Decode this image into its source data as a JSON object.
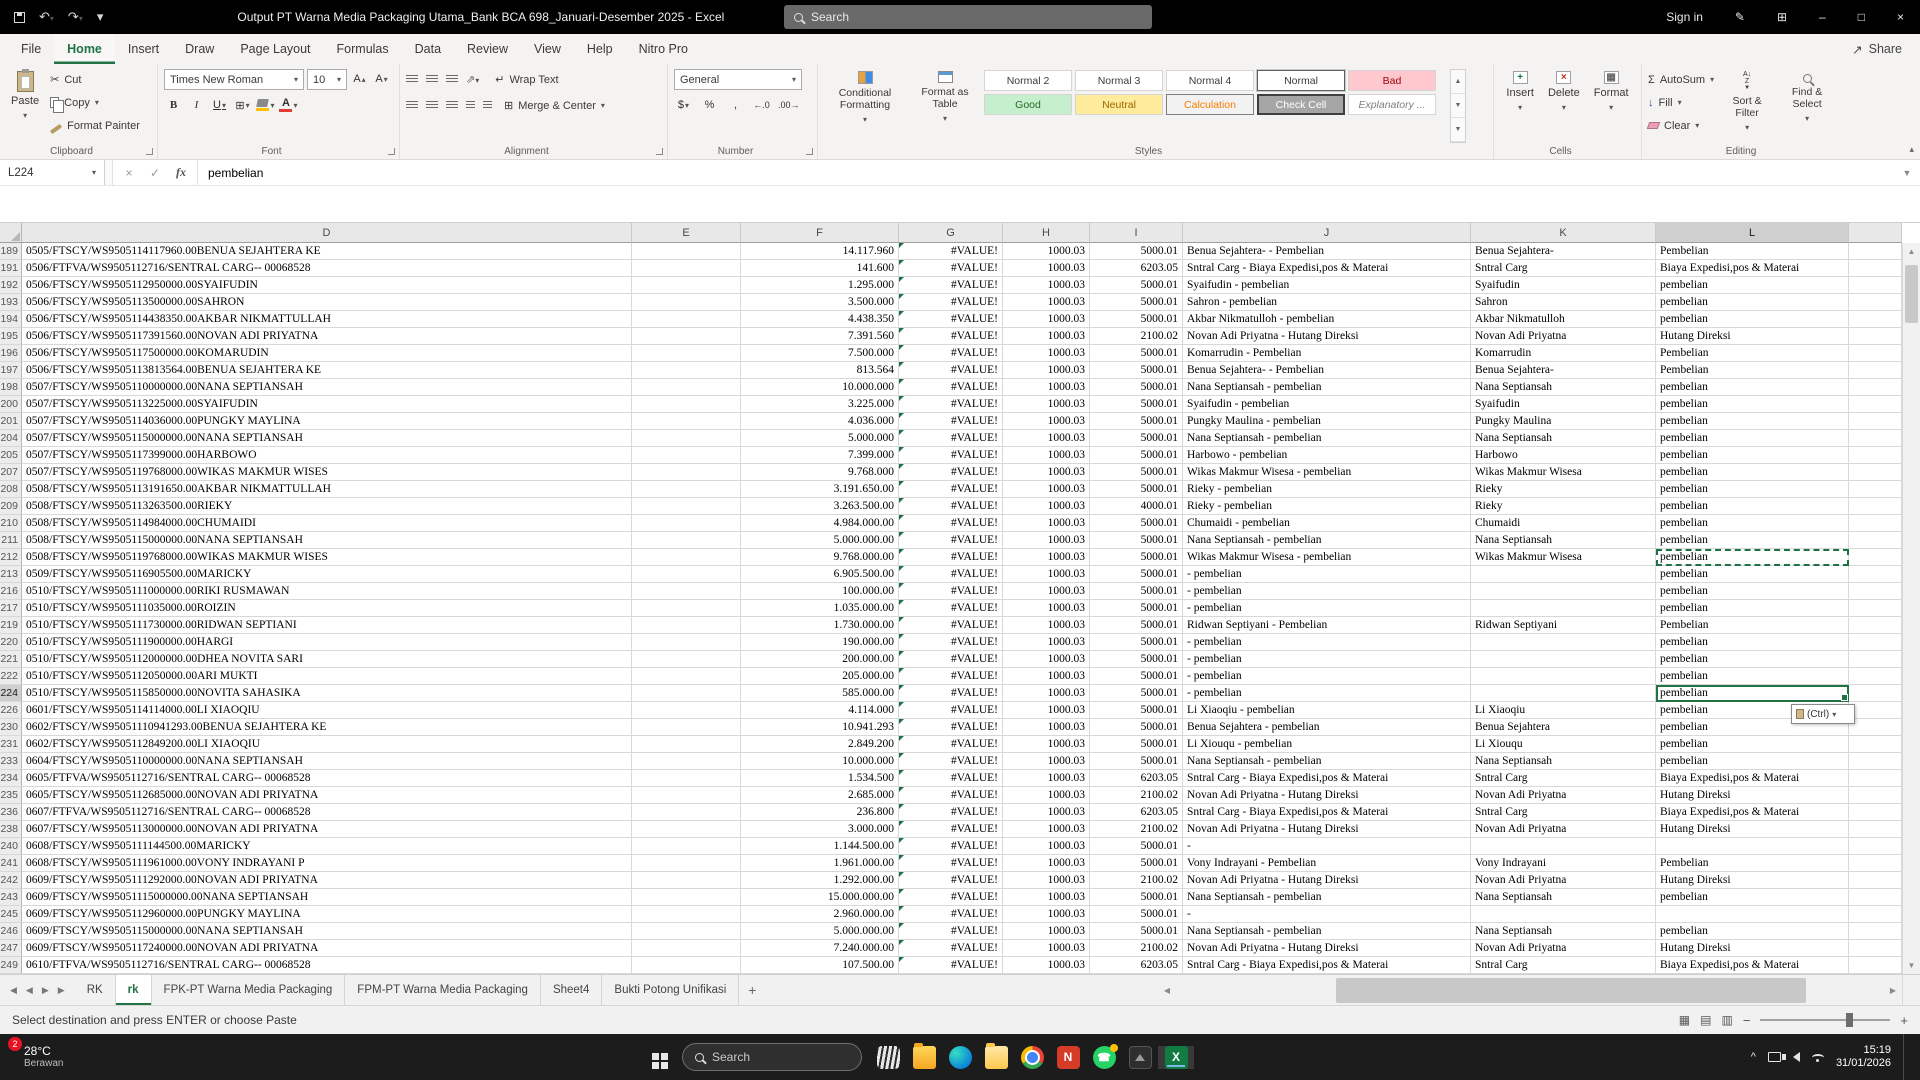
{
  "colors": {
    "accent_green": "#217346",
    "excel_brand": "#107c41",
    "bad_bg": "#ffc7ce",
    "bad_text": "#9c0006",
    "good_bg": "#c6efce",
    "good_text": "#276c24",
    "neutral_bg": "#ffeb9c",
    "neutral_text": "#9c6500",
    "calculation_text": "#fa7d00",
    "check_cell_bg": "#a5a5a5",
    "titlebar_bg": "#000000",
    "taskbar_bg": "#1c1c1c"
  },
  "title_bar": {
    "title": "Output PT Warna Media Packaging Utama_Bank BCA 698_Januari-Desember 2025  -  Excel",
    "search_placeholder": "Search",
    "sign_in": "Sign in"
  },
  "ribbon": {
    "tabs": [
      "File",
      "Home",
      "Insert",
      "Draw",
      "Page Layout",
      "Formulas",
      "Data",
      "Review",
      "View",
      "Help",
      "Nitro Pro"
    ],
    "active_tab": "Home",
    "share_label": "Share",
    "groups": {
      "clipboard": {
        "label": "Clipboard",
        "paste": "Paste",
        "cut": "Cut",
        "copy": "Copy",
        "format_painter": "Format Painter"
      },
      "font": {
        "label": "Font",
        "family": "Times New Roman",
        "size": "10"
      },
      "alignment": {
        "label": "Alignment",
        "wrap_text": "Wrap Text",
        "merge_center": "Merge & Center"
      },
      "number": {
        "label": "Number",
        "format": "General"
      },
      "styles": {
        "label": "Styles",
        "conditional": "Conditional Formatting",
        "format_table": "Format as Table",
        "gallery": [
          [
            "Normal 2",
            "plain"
          ],
          [
            "Normal 3",
            "plain"
          ],
          [
            "Normal 4",
            "plain"
          ],
          [
            "Normal",
            "selected"
          ],
          [
            "Bad",
            "bad"
          ],
          [
            "Good",
            "good"
          ],
          [
            "Neutral",
            "neutral"
          ],
          [
            "Calculation",
            "calc"
          ],
          [
            "Check Cell",
            "check"
          ],
          [
            "Explanatory ...",
            "explan"
          ]
        ]
      },
      "cells": {
        "label": "Cells",
        "insert": "Insert",
        "delete": "Delete",
        "format": "Format"
      },
      "editing": {
        "label": "Editing",
        "autosum": "AutoSum",
        "fill": "Fill",
        "clear": "Clear",
        "sort": "Sort & Filter",
        "find": "Find & Select"
      }
    }
  },
  "formula_bar": {
    "name_box": "L224",
    "formula": "pembelian"
  },
  "sheet": {
    "columns": [
      "D",
      "E",
      "F",
      "G",
      "H",
      "I",
      "J",
      "K",
      "L"
    ],
    "selected_column": "L",
    "selected_row": "224",
    "copied_row": "212",
    "active_cell": "L224",
    "paste_button_label": "(Ctrl)",
    "rows": [
      [
        "189",
        "0505/FTSCY/WS9505114117960.00BENUA SEJAHTERA KE",
        "14.117.960",
        "#VALUE!",
        "1000.03",
        "5000.01",
        "Benua Sejahtera- - Pembelian",
        "Benua Sejahtera-",
        "Pembelian"
      ],
      [
        "191",
        "0506/FTFVA/WS9505112716/SENTRAL CARG-- 00068528",
        "141.600",
        "#VALUE!",
        "1000.03",
        "6203.05",
        "Sntral Carg - Biaya Expedisi,pos & Materai",
        "Sntral Carg",
        "Biaya Expedisi,pos & Materai"
      ],
      [
        "192",
        "0506/FTSCY/WS9505112950000.00SYAIFUDIN",
        "1.295.000",
        "#VALUE!",
        "1000.03",
        "5000.01",
        "Syaifudin - pembelian",
        "Syaifudin",
        "pembelian"
      ],
      [
        "193",
        "0506/FTSCY/WS9505113500000.00SAHRON",
        "3.500.000",
        "#VALUE!",
        "1000.03",
        "5000.01",
        "Sahron - pembelian",
        "Sahron",
        "pembelian"
      ],
      [
        "194",
        "0506/FTSCY/WS9505114438350.00AKBAR NIKMATTULLAH",
        "4.438.350",
        "#VALUE!",
        "1000.03",
        "5000.01",
        "Akbar Nikmatulloh - pembelian",
        "Akbar Nikmatulloh",
        "pembelian"
      ],
      [
        "195",
        "0506/FTSCY/WS9505117391560.00NOVAN ADI PRIYATNA",
        "7.391.560",
        "#VALUE!",
        "1000.03",
        "2100.02",
        "Novan Adi Priyatna - Hutang Direksi",
        "Novan Adi Priyatna",
        "Hutang Direksi"
      ],
      [
        "196",
        "0506/FTSCY/WS9505117500000.00KOMARUDIN",
        "7.500.000",
        "#VALUE!",
        "1000.03",
        "5000.01",
        "Komarrudin - Pembelian",
        "Komarrudin",
        "Pembelian"
      ],
      [
        "197",
        "0506/FTSCY/WS9505113813564.00BENUA SEJAHTERA KE",
        "813.564",
        "#VALUE!",
        "1000.03",
        "5000.01",
        "Benua Sejahtera- - Pembelian",
        "Benua Sejahtera-",
        "Pembelian"
      ],
      [
        "198",
        "0507/FTSCY/WS9505110000000.00NANA SEPTIANSAH",
        "10.000.000",
        "#VALUE!",
        "1000.03",
        "5000.01",
        "Nana Septiansah - pembelian",
        "Nana Septiansah",
        "pembelian"
      ],
      [
        "200",
        "0507/FTSCY/WS9505113225000.00SYAIFUDIN",
        "3.225.000",
        "#VALUE!",
        "1000.03",
        "5000.01",
        "Syaifudin - pembelian",
        "Syaifudin",
        "pembelian"
      ],
      [
        "201",
        "0507/FTSCY/WS9505114036000.00PUNGKY MAYLINA",
        "4.036.000",
        "#VALUE!",
        "1000.03",
        "5000.01",
        "Pungky Maulina - pembelian",
        "Pungky Maulina",
        "pembelian"
      ],
      [
        "204",
        "0507/FTSCY/WS9505115000000.00NANA SEPTIANSAH",
        "5.000.000",
        "#VALUE!",
        "1000.03",
        "5000.01",
        "Nana Septiansah - pembelian",
        "Nana Septiansah",
        "pembelian"
      ],
      [
        "205",
        "0507/FTSCY/WS9505117399000.00HARBOWO",
        "7.399.000",
        "#VALUE!",
        "1000.03",
        "5000.01",
        "Harbowo - pembelian",
        "Harbowo",
        "pembelian"
      ],
      [
        "207",
        "0507/FTSCY/WS9505119768000.00WIKAS MAKMUR WISES",
        "9.768.000",
        "#VALUE!",
        "1000.03",
        "5000.01",
        "Wikas Makmur Wisesa - pembelian",
        "Wikas Makmur Wisesa",
        "pembelian"
      ],
      [
        "208",
        "0508/FTSCY/WS9505113191650.00AKBAR NIKMATTULLAH",
        "3.191.650.00",
        "#VALUE!",
        "1000.03",
        "5000.01",
        "Rieky - pembelian",
        "Rieky",
        "pembelian"
      ],
      [
        "209",
        "0508/FTSCY/WS9505113263500.00RIEKY",
        "3.263.500.00",
        "#VALUE!",
        "1000.03",
        "4000.01",
        "Rieky - pembelian",
        "Rieky",
        "pembelian"
      ],
      [
        "210",
        "0508/FTSCY/WS9505114984000.00CHUMAIDI",
        "4.984.000.00",
        "#VALUE!",
        "1000.03",
        "5000.01",
        "Chumaidi - pembelian",
        "Chumaidi",
        "pembelian"
      ],
      [
        "211",
        "0508/FTSCY/WS9505115000000.00NANA SEPTIANSAH",
        "5.000.000.00",
        "#VALUE!",
        "1000.03",
        "5000.01",
        "Nana Septiansah - pembelian",
        "Nana Septiansah",
        "pembelian"
      ],
      [
        "212",
        "0508/FTSCY/WS9505119768000.00WIKAS MAKMUR WISES",
        "9.768.000.00",
        "#VALUE!",
        "1000.03",
        "5000.01",
        "Wikas Makmur Wisesa - pembelian",
        "Wikas Makmur Wisesa",
        "pembelian"
      ],
      [
        "213",
        "0509/FTSCY/WS9505116905500.00MARICKY",
        "6.905.500.00",
        "#VALUE!",
        "1000.03",
        "5000.01",
        "- pembelian",
        "",
        "pembelian"
      ],
      [
        "216",
        "0510/FTSCY/WS9505111000000.00RIKI RUSMAWAN",
        "100.000.00",
        "#VALUE!",
        "1000.03",
        "5000.01",
        "- pembelian",
        "",
        "pembelian"
      ],
      [
        "217",
        "0510/FTSCY/WS9505111035000.00ROIZIN",
        "1.035.000.00",
        "#VALUE!",
        "1000.03",
        "5000.01",
        "- pembelian",
        "",
        "pembelian"
      ],
      [
        "219",
        "0510/FTSCY/WS9505111730000.00RIDWAN SEPTIANI",
        "1.730.000.00",
        "#VALUE!",
        "1000.03",
        "5000.01",
        "Ridwan Septiyani - Pembelian",
        "Ridwan Septiyani",
        "Pembelian"
      ],
      [
        "220",
        "0510/FTSCY/WS9505111900000.00HARGI",
        "190.000.00",
        "#VALUE!",
        "1000.03",
        "5000.01",
        "- pembelian",
        "",
        "pembelian"
      ],
      [
        "221",
        "0510/FTSCY/WS9505112000000.00DHEA NOVITA SARI",
        "200.000.00",
        "#VALUE!",
        "1000.03",
        "5000.01",
        "- pembelian",
        "",
        "pembelian"
      ],
      [
        "222",
        "0510/FTSCY/WS9505112050000.00ARI MUKTI",
        "205.000.00",
        "#VALUE!",
        "1000.03",
        "5000.01",
        "- pembelian",
        "",
        "pembelian"
      ],
      [
        "224",
        "0510/FTSCY/WS9505115850000.00NOVITA SAHASIKA",
        "585.000.00",
        "#VALUE!",
        "1000.03",
        "5000.01",
        "- pembelian",
        "",
        "pembelian"
      ],
      [
        "226",
        "0601/FTSCY/WS9505114114000.00LI XIAOQIU",
        "4.114.000",
        "#VALUE!",
        "1000.03",
        "5000.01",
        "Li Xiaoqiu - pembelian",
        "Li Xiaoqiu",
        "pembelian"
      ],
      [
        "230",
        "0602/FTSCY/WS95051110941293.00BENUA SEJAHTERA KE",
        "10.941.293",
        "#VALUE!",
        "1000.03",
        "5000.01",
        "Benua Sejahtera - pembelian",
        "Benua Sejahtera",
        "pembelian"
      ],
      [
        "231",
        "0602/FTSCY/WS9505112849200.00LI XIAOQIU",
        "2.849.200",
        "#VALUE!",
        "1000.03",
        "5000.01",
        "Li Xiouqu - pembelian",
        "Li Xiouqu",
        "pembelian"
      ],
      [
        "233",
        "0604/FTSCY/WS9505110000000.00NANA SEPTIANSAH",
        "10.000.000",
        "#VALUE!",
        "1000.03",
        "5000.01",
        "Nana Septiansah - pembelian",
        "Nana Septiansah",
        "pembelian"
      ],
      [
        "234",
        "0605/FTFVA/WS9505112716/SENTRAL CARG-- 00068528",
        "1.534.500",
        "#VALUE!",
        "1000.03",
        "6203.05",
        "Sntral Carg - Biaya Expedisi,pos & Materai",
        "Sntral Carg",
        "Biaya Expedisi,pos & Materai"
      ],
      [
        "235",
        "0605/FTSCY/WS9505112685000.00NOVAN ADI PRIYATNA",
        "2.685.000",
        "#VALUE!",
        "1000.03",
        "2100.02",
        "Novan Adi Priyatna - Hutang Direksi",
        "Novan Adi Priyatna",
        "Hutang Direksi"
      ],
      [
        "236",
        "0607/FTFVA/WS9505112716/SENTRAL CARG-- 00068528",
        "236.800",
        "#VALUE!",
        "1000.03",
        "6203.05",
        "Sntral Carg - Biaya Expedisi,pos & Materai",
        "Sntral Carg",
        "Biaya Expedisi,pos & Materai"
      ],
      [
        "238",
        "0607/FTSCY/WS9505113000000.00NOVAN ADI PRIYATNA",
        "3.000.000",
        "#VALUE!",
        "1000.03",
        "2100.02",
        "Novan Adi Priyatna - Hutang Direksi",
        "Novan Adi Priyatna",
        "Hutang Direksi"
      ],
      [
        "240",
        "0608/FTSCY/WS9505111144500.00MARICKY",
        "1.144.500.00",
        "#VALUE!",
        "1000.03",
        "5000.01",
        "-",
        "",
        ""
      ],
      [
        "241",
        "0608/FTSCY/WS9505111961000.00VONY INDRAYANI P",
        "1.961.000.00",
        "#VALUE!",
        "1000.03",
        "5000.01",
        "Vony Indrayani - Pembelian",
        "Vony Indrayani",
        "Pembelian"
      ],
      [
        "242",
        "0609/FTSCY/WS9505111292000.00NOVAN ADI PRIYATNA",
        "1.292.000.00",
        "#VALUE!",
        "1000.03",
        "2100.02",
        "Novan Adi Priyatna - Hutang Direksi",
        "Novan Adi Priyatna",
        "Hutang Direksi"
      ],
      [
        "243",
        "0609/FTSCY/WS95051115000000.00NANA SEPTIANSAH",
        "15.000.000.00",
        "#VALUE!",
        "1000.03",
        "5000.01",
        "Nana Septiansah - pembelian",
        "Nana Septiansah",
        "pembelian"
      ],
      [
        "245",
        "0609/FTSCY/WS9505112960000.00PUNGKY MAYLINA",
        "2.960.000.00",
        "#VALUE!",
        "1000.03",
        "5000.01",
        "-",
        "",
        ""
      ],
      [
        "246",
        "0609/FTSCY/WS9505115000000.00NANA SEPTIANSAH",
        "5.000.000.00",
        "#VALUE!",
        "1000.03",
        "5000.01",
        "Nana Septiansah - pembelian",
        "Nana Septiansah",
        "pembelian"
      ],
      [
        "247",
        "0609/FTSCY/WS9505117240000.00NOVAN ADI PRIYATNA",
        "7.240.000.00",
        "#VALUE!",
        "1000.03",
        "2100.02",
        "Novan Adi Priyatna - Hutang Direksi",
        "Novan Adi Priyatna",
        "Hutang Direksi"
      ],
      [
        "249",
        "0610/FTFVA/WS9505112716/SENTRAL CARG-- 00068528",
        "107.500.00",
        "#VALUE!",
        "1000.03",
        "6203.05",
        "Sntral Carg - Biaya Expedisi,pos & Materai",
        "Sntral Carg",
        "Biaya Expedisi,pos & Materai"
      ]
    ]
  },
  "sheet_tabs": {
    "tabs": [
      "RK",
      "rk",
      "FPK-PT Warna Media Packaging",
      "FPM-PT Warna Media Packaging",
      "Sheet4",
      "Bukti Potong Unifikasi"
    ],
    "active": "rk"
  },
  "status_bar": {
    "message": "Select destination and press ENTER or choose Paste"
  },
  "taskbar": {
    "badge": "2",
    "temp": "28°C",
    "condition": "Berawan",
    "search_placeholder": "Search",
    "icons": [
      "zebra",
      "file-explorer",
      "edge",
      "folder",
      "chrome",
      "nitro",
      "whatsapp",
      "photos",
      "excel"
    ],
    "time": "15:19",
    "date": "31/01/2026"
  }
}
